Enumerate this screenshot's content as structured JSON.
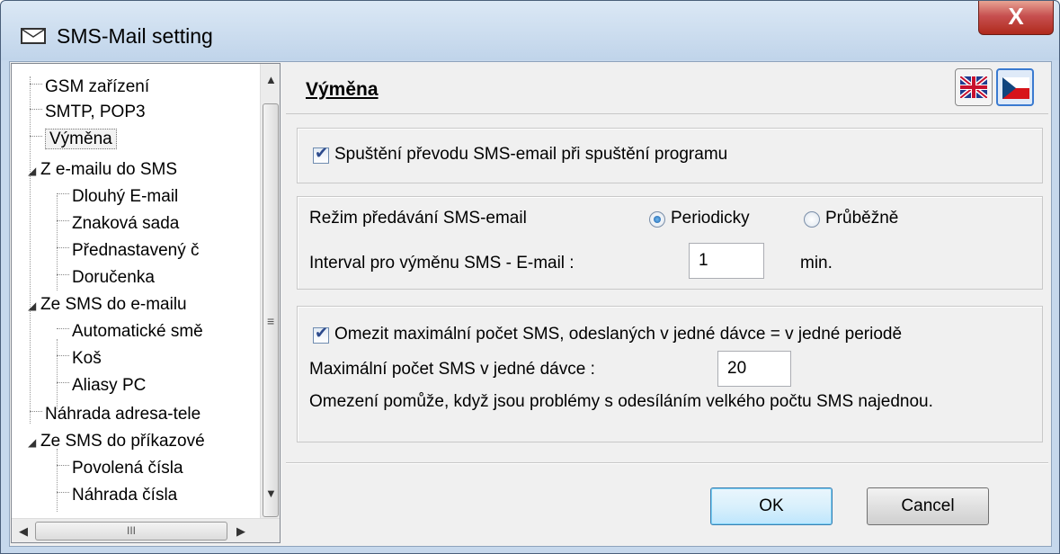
{
  "window": {
    "title": "SMS-Mail setting",
    "close_label": "X"
  },
  "tree": {
    "items": [
      {
        "label": "GSM zařízení"
      },
      {
        "label": "SMTP, POP3"
      },
      {
        "label": "Výměna"
      },
      {
        "label": "Z e-mailu do SMS"
      },
      {
        "label": "Dlouhý E-mail"
      },
      {
        "label": "Znaková sada"
      },
      {
        "label": "Přednastavený č"
      },
      {
        "label": "Doručenka"
      },
      {
        "label": "Ze SMS do e-mailu"
      },
      {
        "label": "Automatické smě"
      },
      {
        "label": "Koš"
      },
      {
        "label": "Aliasy PC"
      },
      {
        "label": "Náhrada adresa-tele"
      },
      {
        "label": "Ze SMS do příkazové"
      },
      {
        "label": "Povolená čísla"
      },
      {
        "label": "Náhrada čísla"
      }
    ],
    "selected": "Výměna",
    "hscroll_grip": "III"
  },
  "panel": {
    "title": "Výměna",
    "startup": {
      "label": "Spuštění převodu SMS-email při spuštění programu",
      "checked": true
    },
    "mode": {
      "label": "Režim předávání SMS-email",
      "option_periodic": "Periodicky",
      "option_continuous": "Průběžně",
      "selected": "Periodicky"
    },
    "interval": {
      "label": "Interval pro výměnu SMS - E-mail :",
      "value": "1",
      "unit": "min."
    },
    "limit": {
      "label": "Omezit maximální počet SMS, odeslaných v jedné dávce = v jedné periodě",
      "checked": true,
      "max_label": "Maximální počet SMS v jedné dávce :",
      "max_value": "20",
      "note": "Omezení pomůže, když jsou problémy s odesíláním velkého počtu SMS najednou."
    }
  },
  "buttons": {
    "ok": "OK",
    "cancel": "Cancel"
  },
  "colors": {
    "title_bg": "#c6d8ec",
    "client_bg": "#f0f0f0",
    "close_red": "#c75050",
    "accent": "#3c7fb1"
  }
}
